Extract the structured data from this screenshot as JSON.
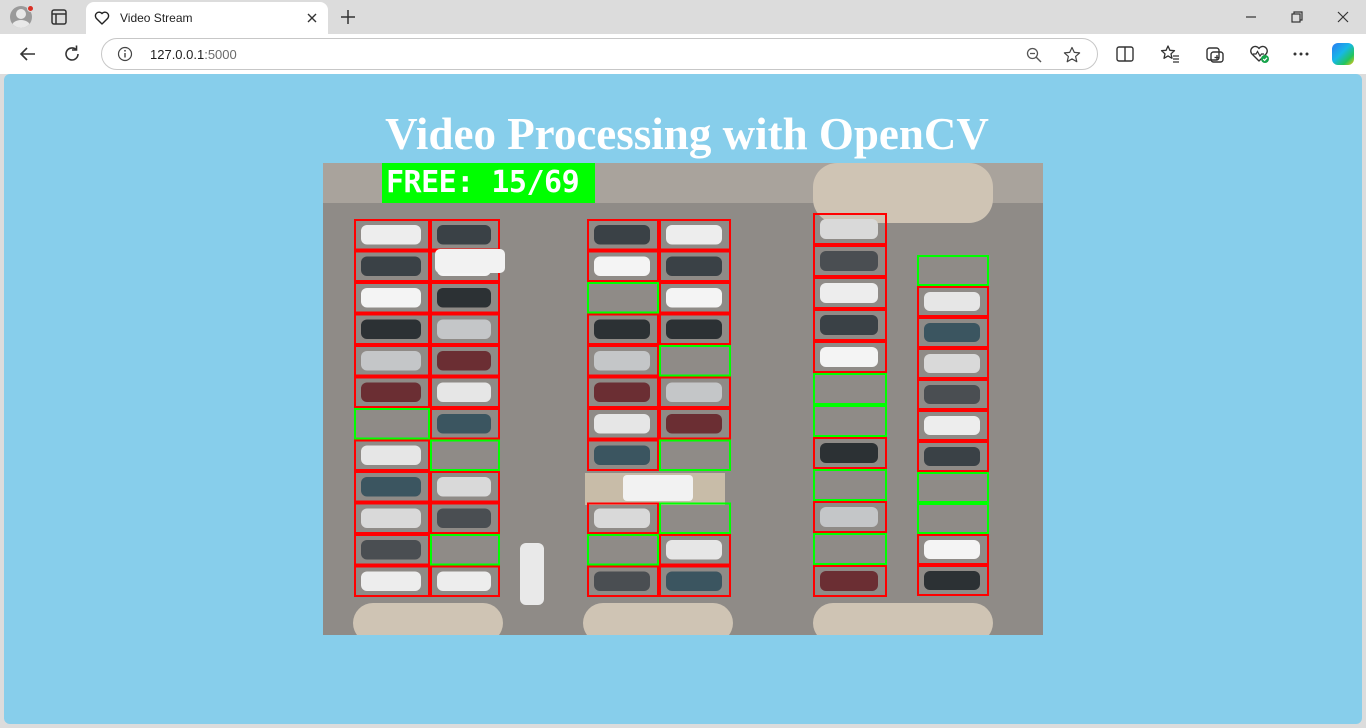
{
  "browser": {
    "tab_title": "Video Stream",
    "address": {
      "host": "127.0.0.1",
      "port": ":5000"
    }
  },
  "page": {
    "heading": "Video Processing with OpenCV",
    "background_color": "#87ceeb",
    "heading_color": "#ffffff"
  },
  "video": {
    "free_label": "FREE: 15/69",
    "free_label_bg": "#00ff00",
    "occupied_color": "#ff0000",
    "free_color": "#00ff00",
    "free_count": 15,
    "total_spots": 69
  }
}
